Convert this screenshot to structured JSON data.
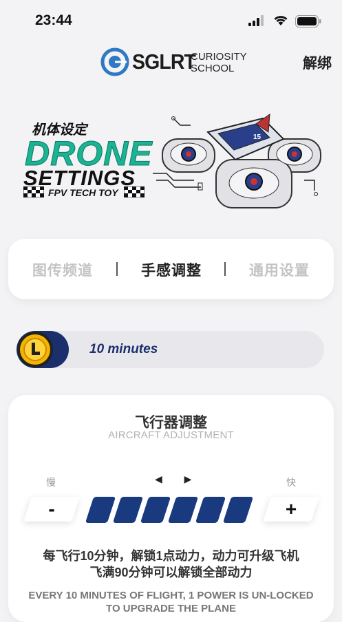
{
  "status_bar": {
    "time": "23:44"
  },
  "header": {
    "logo_main": "SGLRT",
    "logo_sub_1": "CURIOSITY",
    "logo_sub_2": "SCHOOL",
    "unbind_label": "解绑"
  },
  "hero": {
    "title_cn": "机体设定",
    "title_line1": "DRONE",
    "title_line2": "SETTINGS",
    "tagline": "FPV TECH TOY",
    "drone_badge": "15"
  },
  "tabs": [
    {
      "label": "图传频道",
      "active": false
    },
    {
      "label": "手感调整",
      "active": true
    },
    {
      "label": "通用设置",
      "active": false
    }
  ],
  "flight_timer": {
    "text": "10 minutes",
    "accent": "#1a2f6b",
    "coin_color": "#f5b400"
  },
  "adjustment": {
    "title_cn": "飞行器调整",
    "title_en": "AIRCRAFT ADJUSTMENT",
    "slow_label": "慢",
    "fast_label": "快",
    "arrows": "◀ ▶",
    "minus_label": "-",
    "plus_label": "+",
    "level": 6,
    "level_max": 6,
    "level_color": "#1a3a80",
    "description_cn_line1": "每飞行10分钟，解锁1点动力，动力可升级飞机",
    "description_cn_line2": "飞满90分钟可以解锁全部动力",
    "description_en": "EVERY 10 MINUTES OF FLIGHT, 1 POWER IS UN-LOCKED TO UPGRADE THE PLANE"
  }
}
